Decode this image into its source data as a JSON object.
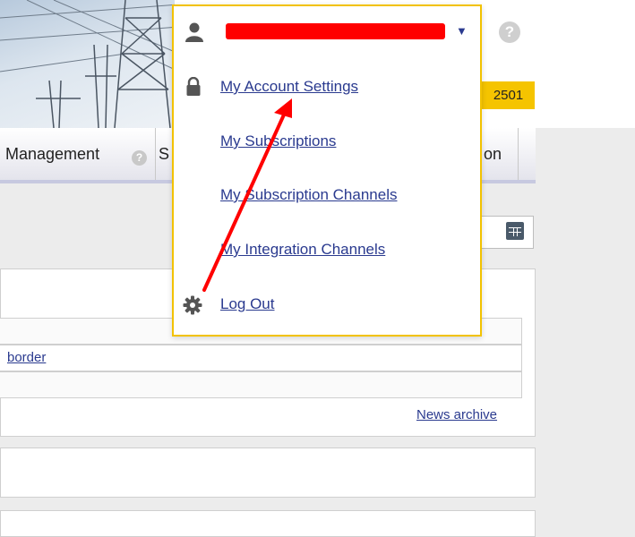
{
  "header": {
    "help_glyph": "?",
    "user_number": "2501"
  },
  "nav": {
    "management_label": "Management",
    "help_glyph": "?",
    "partial_s": "S",
    "partial_on": "on"
  },
  "news": {
    "row_link": "border",
    "archive_link": "News archive"
  },
  "menu": {
    "items": [
      {
        "label": "My Account Settings",
        "icon": "lock-icon"
      },
      {
        "label": "My Subscriptions",
        "icon": ""
      },
      {
        "label": "My Subscription Channels",
        "icon": ""
      },
      {
        "label": "My Integration Channels",
        "icon": ""
      },
      {
        "label": "Log Out",
        "icon": "gear-icon"
      }
    ]
  },
  "colors": {
    "accent_yellow": "#f5c400",
    "link_blue": "#2a3a8f",
    "annotation_red": "#ff0000"
  }
}
